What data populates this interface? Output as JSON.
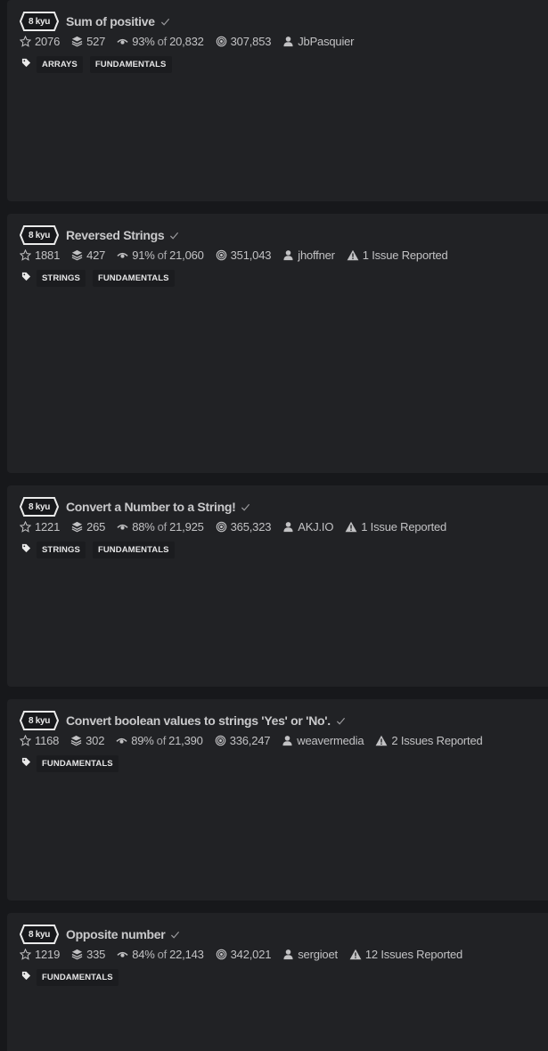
{
  "katas": [
    {
      "rank": "8 kyu",
      "title": "Sum of positive",
      "stars": "2076",
      "collections": "527",
      "satisfaction_pct": "93%",
      "satisfaction_of": "of",
      "votes": "20,832",
      "completed": "307,853",
      "author": "JbPasquier",
      "issues": "",
      "tags": [
        "ARRAYS",
        "FUNDAMENTALS"
      ]
    },
    {
      "rank": "8 kyu",
      "title": "Reversed Strings",
      "stars": "1881",
      "collections": "427",
      "satisfaction_pct": "91%",
      "satisfaction_of": "of",
      "votes": "21,060",
      "completed": "351,043",
      "author": "jhoffner",
      "issues": "1 Issue Reported",
      "tags": [
        "STRINGS",
        "FUNDAMENTALS"
      ]
    },
    {
      "rank": "8 kyu",
      "title": "Convert a Number to a String!",
      "stars": "1221",
      "collections": "265",
      "satisfaction_pct": "88%",
      "satisfaction_of": "of",
      "votes": "21,925",
      "completed": "365,323",
      "author": "AKJ.IO",
      "issues": "1 Issue Reported",
      "tags": [
        "STRINGS",
        "FUNDAMENTALS"
      ]
    },
    {
      "rank": "8 kyu",
      "title": "Convert boolean values to strings 'Yes' or 'No'.",
      "stars": "1168",
      "collections": "302",
      "satisfaction_pct": "89%",
      "satisfaction_of": "of",
      "votes": "21,390",
      "completed": "336,247",
      "author": "weavermedia",
      "issues": "2 Issues Reported",
      "tags": [
        "FUNDAMENTALS"
      ]
    },
    {
      "rank": "8 kyu",
      "title": "Opposite number",
      "stars": "1219",
      "collections": "335",
      "satisfaction_pct": "84%",
      "satisfaction_of": "of",
      "votes": "22,143",
      "completed": "342,021",
      "author": "sergioet",
      "issues": "12 Issues Reported",
      "tags": [
        "FUNDAMENTALS"
      ]
    }
  ],
  "colors": {
    "background": "#17181b",
    "card": "#212225",
    "tag_background": "#1b1c1f",
    "text": "#c2c2c4",
    "title": "#c9c9cb"
  },
  "icons": {
    "rank": "hexagon-badge-icon",
    "completed_check": "checkmark-icon",
    "stars": "star-icon",
    "collections": "stack-icon",
    "satisfaction": "eye-icon",
    "completed": "target-icon",
    "author": "user-icon",
    "issues": "warning-icon",
    "tags": "tag-icon"
  }
}
